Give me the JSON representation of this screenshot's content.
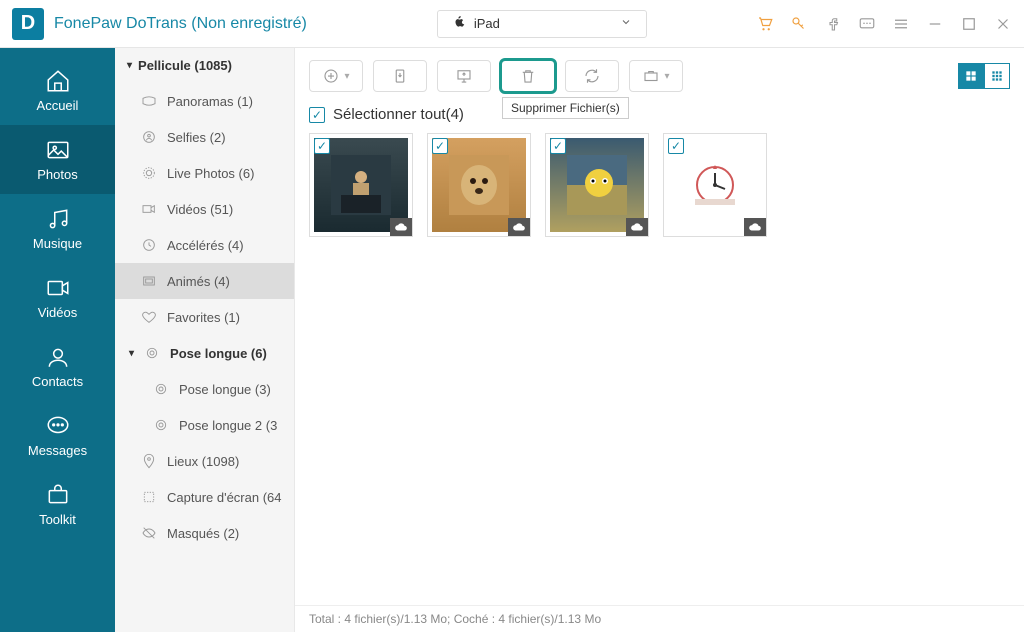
{
  "app": {
    "title": "FonePaw DoTrans (Non enregistré)"
  },
  "device": {
    "label": "iPad"
  },
  "nav": {
    "home": "Accueil",
    "photos": "Photos",
    "music": "Musique",
    "videos": "Vidéos",
    "contacts": "Contacts",
    "messages": "Messages",
    "toolkit": "Toolkit"
  },
  "albums": {
    "header": "Pellicule (1085)",
    "panoramas": "Panoramas (1)",
    "selfies": "Selfies (2)",
    "livephotos": "Live Photos (6)",
    "videos": "Vidéos (51)",
    "timelapse": "Accélérés (4)",
    "animated": "Animés (4)",
    "favorites": "Favorites (1)",
    "longexposure_head": "Pose longue (6)",
    "longexposure_1": "Pose longue (3)",
    "longexposure_2": "Pose longue 2 (3",
    "places": "Lieux (1098)",
    "screenshots": "Capture d'écran (64",
    "hidden": "Masqués (2)"
  },
  "toolbar": {
    "delete_tooltip": "Supprimer Fichier(s)"
  },
  "select_all": "Sélectionner tout(4)",
  "status": "Total : 4 fichier(s)/1.13 Mo; Coché : 4 fichier(s)/1.13 Mo"
}
